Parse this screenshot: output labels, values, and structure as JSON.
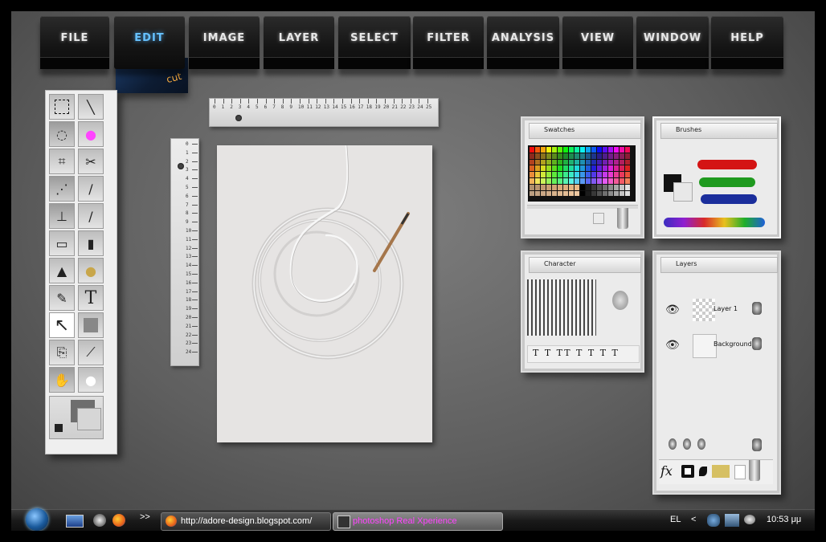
{
  "menu": {
    "items": [
      {
        "label": "FILE"
      },
      {
        "label": "EDIT"
      },
      {
        "label": "IMAGE"
      },
      {
        "label": "LAYER"
      },
      {
        "label": "SELECT"
      },
      {
        "label": "FILTER"
      },
      {
        "label": "ANALYSIS"
      },
      {
        "label": "VIEW"
      },
      {
        "label": "WINDOW"
      },
      {
        "label": "HELP"
      }
    ],
    "active": "EDIT",
    "submenu_label": "cut"
  },
  "panels": {
    "swatches": {
      "tab_label": "Swatches"
    },
    "brushes": {
      "tab_label": "Brushes"
    },
    "character": {
      "tab_label": "Character"
    },
    "layers": {
      "tab_label": "Layers",
      "rows": [
        {
          "name": "Layer 1"
        },
        {
          "name": "Background"
        }
      ]
    }
  },
  "colors": {
    "accent_active": "#67c2ff",
    "cut_text": "#ffb040",
    "title_pink": "#ff44ff"
  },
  "taskbar": {
    "url_button": "http://adore-design.blogspot.com/",
    "active_window": "photoshop Real Xperience",
    "overflow": ">>",
    "language": "EL",
    "tray_arrow": "<",
    "clock": "10:53 μμ"
  }
}
